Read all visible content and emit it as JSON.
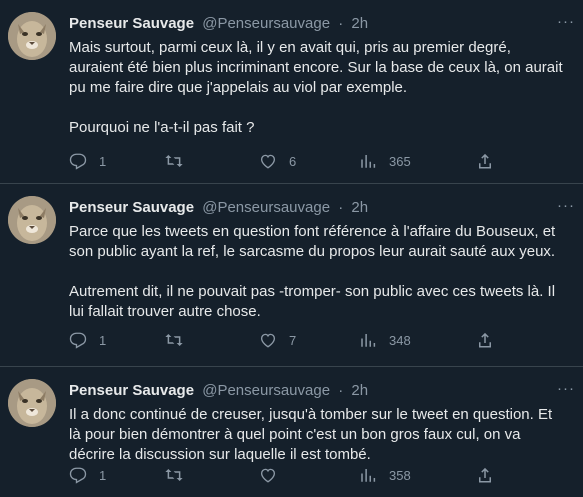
{
  "tweets": [
    {
      "author_name": "Penseur Sauvage",
      "handle": "@Penseursauvage",
      "separator": "·",
      "time": "2h",
      "more": "···",
      "paragraphs": [
        [
          "Mais surtout, parmi ceux là, il y en avait qui, pris au premier degré,",
          "auraient été bien plus incriminant encore. Sur la base de ceux là, on aurait",
          "pu me faire dire que j'appelais au viol par exemple."
        ],
        [
          "Pourquoi ne l'a-t-il pas fait ?"
        ]
      ],
      "replies": "1",
      "retweets": "",
      "likes": "6",
      "views": "365"
    },
    {
      "author_name": "Penseur Sauvage",
      "handle": "@Penseursauvage",
      "separator": "·",
      "time": "2h",
      "more": "···",
      "paragraphs": [
        [
          "Parce que les tweets en question font référence à l'affaire du Bouseux, et",
          "son public ayant la ref, le sarcasme du propos leur aurait sauté aux yeux."
        ],
        [
          "Autrement dit, il ne pouvait pas -tromper- son public avec ces tweets là. Il",
          "lui fallait trouver autre chose."
        ]
      ],
      "replies": "1",
      "retweets": "",
      "likes": "7",
      "views": "348"
    },
    {
      "author_name": "Penseur Sauvage",
      "handle": "@Penseursauvage",
      "separator": "·",
      "time": "2h",
      "more": "···",
      "paragraphs": [
        [
          "Il a donc continué de creuser, jusqu'à tomber sur le tweet en question. Et",
          "là pour bien démontrer à quel point c'est un bon gros faux cul, on va",
          "décrire la discussion sur laquelle il est tombé."
        ]
      ],
      "replies": "1",
      "retweets": "",
      "likes": "",
      "views": "358"
    }
  ],
  "colors": {
    "background": "#15202b",
    "text": "#e7e9ea",
    "secondary": "#8b98a5",
    "divider": "#38444d"
  },
  "icons": [
    "reply-icon",
    "retweet-icon",
    "like-icon",
    "views-icon",
    "share-icon",
    "more-icon"
  ]
}
